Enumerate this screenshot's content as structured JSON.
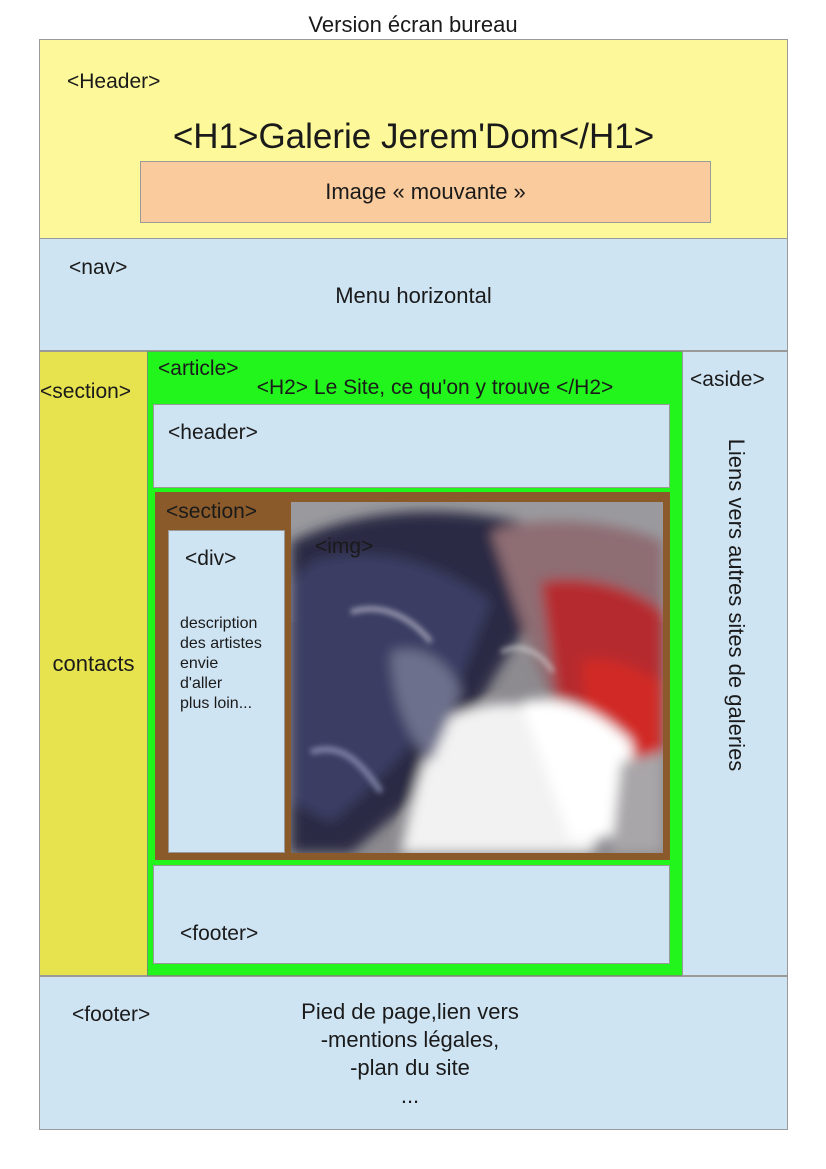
{
  "title": "Version écran bureau",
  "header": {
    "tag": "<Header>",
    "h1": "<H1>Galerie Jerem'Dom</H1>",
    "image_label": "Image « mouvante »"
  },
  "nav": {
    "tag": "<nav>",
    "label": "Menu horizontal"
  },
  "left_section": {
    "tag": "<section>",
    "label": "contacts"
  },
  "article": {
    "tag": "<article>",
    "h2": "<H2> Le Site, ce qu'on y trouve </H2>",
    "header_tag": "<header>",
    "section_tag": "<section>",
    "div_tag": "<div>",
    "div_text": [
      "description",
      "des artistes",
      "envie",
      "d'aller",
      "plus loin..."
    ],
    "img_tag": "<img>",
    "footer_tag": "<footer>"
  },
  "aside": {
    "tag": "<aside>",
    "label": "Liens vers autres sites de galeries"
  },
  "footer": {
    "tag": "<footer>",
    "lines": [
      "Pied de page,lien vers",
      "-mentions légales,",
      "-plan du site",
      "..."
    ]
  },
  "colors": {
    "header": "#fdf99a",
    "image_bar": "#facb9c",
    "blue_blocks": "#cfe4f3",
    "left_section": "#e6e34e",
    "article": "#22f51c",
    "inner_section": "#8a5a2b"
  }
}
